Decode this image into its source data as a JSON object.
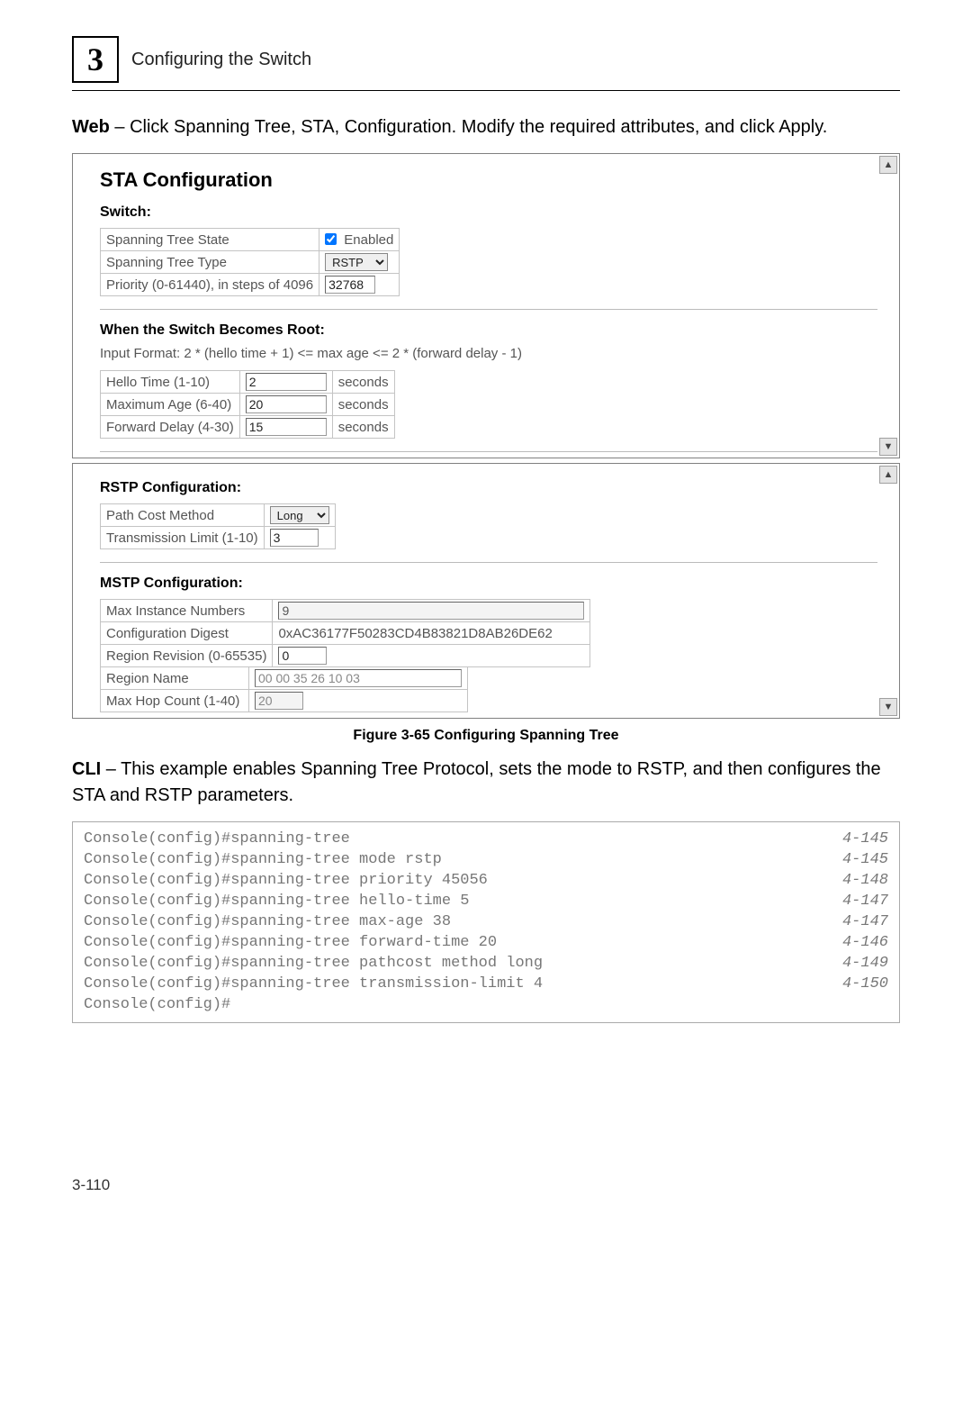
{
  "header": {
    "chapter_number": "3",
    "chapter_title": "Configuring the Switch"
  },
  "intro": {
    "web_bold": "Web",
    "web_text": " – Click Spanning Tree, STA, Configuration. Modify the required attributes, and click Apply."
  },
  "sta": {
    "title": "STA Configuration",
    "switch_heading": "Switch:",
    "rows": {
      "state_label": "Spanning Tree State",
      "state_enabled_label": " Enabled",
      "type_label": "Spanning Tree Type",
      "type_value": "RSTP",
      "priority_label": "Priority (0-61440), in steps of 4096",
      "priority_value": "32768"
    },
    "root_heading": "When the Switch Becomes Root:",
    "input_format": "Input Format: 2 * (hello time + 1) <= max age <= 2 * (forward delay - 1)",
    "root_rows": {
      "hello_label": "Hello Time (1-10)",
      "hello_value": "2",
      "hello_unit": "seconds",
      "maxage_label": "Maximum Age (6-40)",
      "maxage_value": "20",
      "maxage_unit": "seconds",
      "fwd_label": "Forward Delay (4-30)",
      "fwd_value": "15",
      "fwd_unit": "seconds"
    }
  },
  "rstp": {
    "heading": "RSTP Configuration:",
    "path_label": "Path Cost Method",
    "path_value": "Long",
    "trans_label": "Transmission Limit (1-10)",
    "trans_value": "3"
  },
  "mstp": {
    "heading": "MSTP Configuration:",
    "max_inst_label": "Max Instance Numbers",
    "max_inst_value": "9",
    "digest_label": "Configuration Digest",
    "digest_value": "0xAC36177F50283CD4B83821D8AB26DE62",
    "rev_label": "Region Revision (0-65535)",
    "rev_value": "0",
    "name_label": "Region Name",
    "name_value": "00 00 35 26 10 03",
    "hop_label": "Max Hop Count (1-40)",
    "hop_value": "20"
  },
  "figure_caption": "Figure 3-65   Configuring Spanning Tree",
  "cli_intro": {
    "bold": "CLI",
    "text": " – This example enables Spanning Tree Protocol, sets the mode to RSTP, and then configures the STA and RSTP parameters."
  },
  "cli": [
    {
      "cmd": "Console(config)#spanning-tree",
      "ref": "4-145"
    },
    {
      "cmd": "Console(config)#spanning-tree mode rstp",
      "ref": "4-145"
    },
    {
      "cmd": "Console(config)#spanning-tree priority 45056",
      "ref": "4-148"
    },
    {
      "cmd": "Console(config)#spanning-tree hello-time 5",
      "ref": "4-147"
    },
    {
      "cmd": "Console(config)#spanning-tree max-age 38",
      "ref": "4-147"
    },
    {
      "cmd": "Console(config)#spanning-tree forward-time 20",
      "ref": "4-146"
    },
    {
      "cmd": "Console(config)#spanning-tree pathcost method long",
      "ref": "4-149"
    },
    {
      "cmd": "Console(config)#spanning-tree transmission-limit 4",
      "ref": "4-150"
    },
    {
      "cmd": "Console(config)#",
      "ref": ""
    }
  ],
  "page_number": "3-110"
}
